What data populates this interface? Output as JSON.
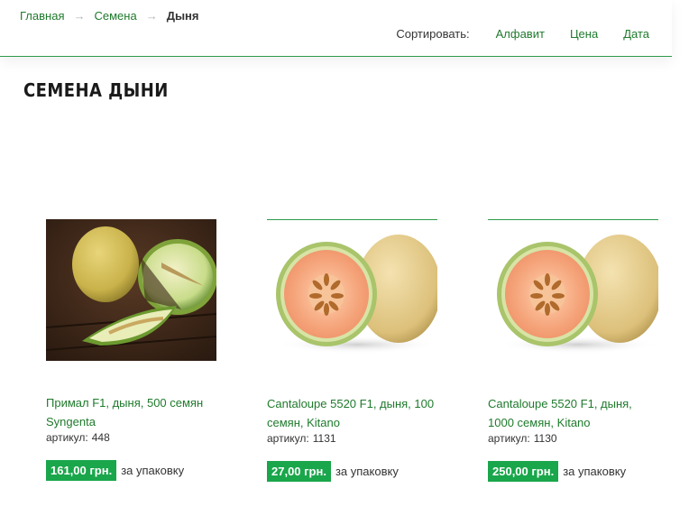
{
  "breadcrumb": {
    "items": [
      "Главная",
      "Семена"
    ],
    "separator": "→",
    "current": "Дыня"
  },
  "sort": {
    "label": "Сортировать:",
    "options": [
      "Алфавит",
      "Цена",
      "Дата"
    ]
  },
  "page": {
    "title": "СЕМЕНА ДЫНИ"
  },
  "products": [
    {
      "name": "Примал F1, дыня, 500 семян Syngenta",
      "sku_label": "артикул:",
      "sku": "448",
      "price": "161,00 грн.",
      "unit": "за упаковку",
      "image": "melon-photo-dark"
    },
    {
      "name": "Cantaloupe 5520 F1, дыня, 100 семян, Kitano",
      "sku_label": "артикул:",
      "sku": "1131",
      "price": "27,00 грн.",
      "unit": "за упаковку",
      "image": "cantaloupe-halves"
    },
    {
      "name": "Cantaloupe 5520 F1, дыня, 1000 семян, Kitano",
      "sku_label": "артикул:",
      "sku": "1130",
      "price": "250,00 грн.",
      "unit": "за упаковку",
      "image": "cantaloupe-halves"
    }
  ],
  "colors": {
    "accent": "#1aa64b",
    "link": "#1f7a2c",
    "divider": "#2e9a4a"
  }
}
